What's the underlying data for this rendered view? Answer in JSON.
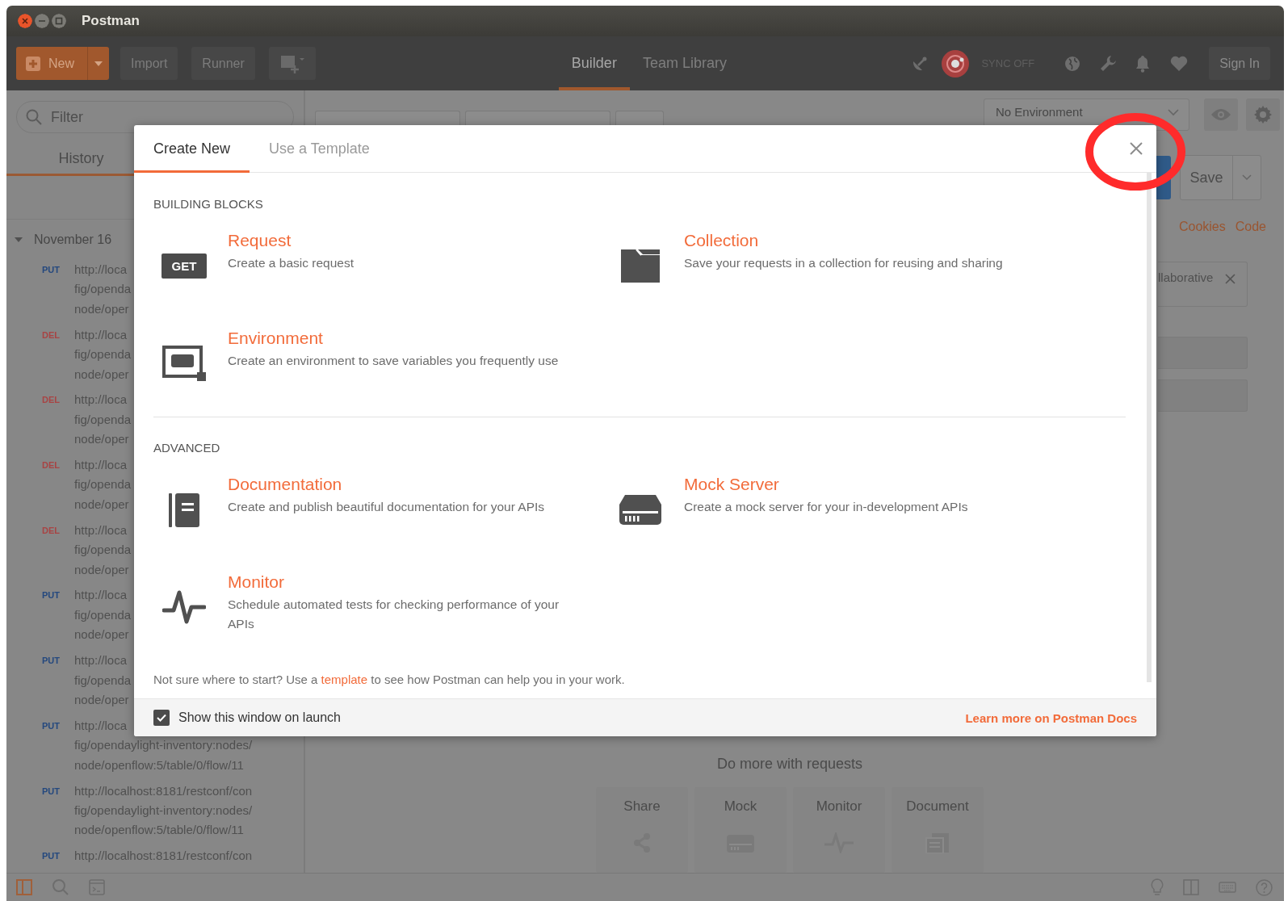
{
  "window": {
    "title": "Postman"
  },
  "toolbar": {
    "new_button": "New",
    "buttons": [
      "Import",
      "Runner"
    ],
    "tabs": [
      {
        "label": "Builder",
        "selected": true
      },
      {
        "label": "Team Library",
        "selected": false
      }
    ],
    "sync_status": "SYNC OFF",
    "sign_in": "Sign In"
  },
  "sidebar": {
    "filter_placeholder": "Filter",
    "tabs": [
      {
        "label": "History",
        "selected": true
      }
    ],
    "groups": [
      {
        "label": "November 16",
        "expanded": true,
        "items": [
          {
            "method": "PUT",
            "color": "#24487e",
            "url_lines": [
              "http://loca",
              "fig/openda",
              "node/oper"
            ]
          },
          {
            "method": "DEL",
            "color": "#a84444",
            "url_lines": [
              "http://loca",
              "fig/openda",
              "node/oper"
            ]
          },
          {
            "method": "DEL",
            "color": "#a84444",
            "url_lines": [
              "http://loca",
              "fig/openda",
              "node/oper"
            ]
          },
          {
            "method": "DEL",
            "color": "#a84444",
            "url_lines": [
              "http://loca",
              "fig/openda",
              "node/oper"
            ]
          },
          {
            "method": "DEL",
            "color": "#a84444",
            "url_lines": [
              "http://loca",
              "fig/openda",
              "node/oper"
            ]
          },
          {
            "method": "PUT",
            "color": "#24487e",
            "url_lines": [
              "http://loca",
              "fig/openda",
              "node/oper"
            ]
          },
          {
            "method": "PUT",
            "color": "#24487e",
            "url_lines": [
              "http://loca",
              "fig/openda",
              "node/oper"
            ]
          },
          {
            "method": "PUT",
            "color": "#24487e",
            "url_lines": [
              "http://loca",
              "fig/opendaylight-inventory:nodes/",
              "node/openflow:5/table/0/flow/11"
            ]
          },
          {
            "method": "PUT",
            "color": "#24487e",
            "url_lines": [
              "http://localhost:8181/restconf/con",
              "fig/opendaylight-inventory:nodes/",
              "node/openflow:5/table/0/flow/11"
            ]
          },
          {
            "method": "PUT",
            "color": "#24487e",
            "url_lines": [
              "http://localhost:8181/restconf/con"
            ]
          }
        ]
      }
    ]
  },
  "main": {
    "environment": "No Environment",
    "save_button": "Save",
    "links": [
      "Cookies",
      "Code"
    ],
    "notice": "llaborative",
    "empty_state": {
      "title": "Do more with requests",
      "actions": [
        {
          "label": "Share",
          "kind": "share"
        },
        {
          "label": "Mock",
          "kind": "mock"
        },
        {
          "label": "Monitor",
          "kind": "monitor"
        },
        {
          "label": "Document",
          "kind": "document"
        }
      ]
    }
  },
  "modal": {
    "tabs": [
      {
        "label": "Create New",
        "selected": true
      },
      {
        "label": "Use a Template",
        "selected": false
      }
    ],
    "sections": [
      {
        "title": "BUILDING BLOCKS",
        "items": [
          {
            "kind": "request",
            "badge": "GET",
            "title": "Request",
            "description": "Create a basic request"
          },
          {
            "kind": "collection",
            "title": "Collection",
            "description": "Save your requests in a collection for reusing and sharing"
          },
          {
            "kind": "environment",
            "title": "Environment",
            "description": "Create an environment to save variables you frequently use"
          }
        ]
      },
      {
        "title": "ADVANCED",
        "items": [
          {
            "kind": "documentation",
            "title": "Documentation",
            "description": "Create and publish beautiful documentation for your APIs"
          },
          {
            "kind": "mock_server",
            "title": "Mock Server",
            "description": "Create a mock server for your in-development APIs"
          },
          {
            "kind": "monitor",
            "title": "Monitor",
            "description": "Schedule automated tests for checking performance of your APIs"
          }
        ]
      }
    ],
    "hint": {
      "before": "Not sure where to start? Use a ",
      "link": "template",
      "after": " to see how Postman can help you in your work."
    },
    "show_on_launch": {
      "label": "Show this window on launch",
      "checked": true
    },
    "docs_link": "Learn more on Postman Docs"
  }
}
